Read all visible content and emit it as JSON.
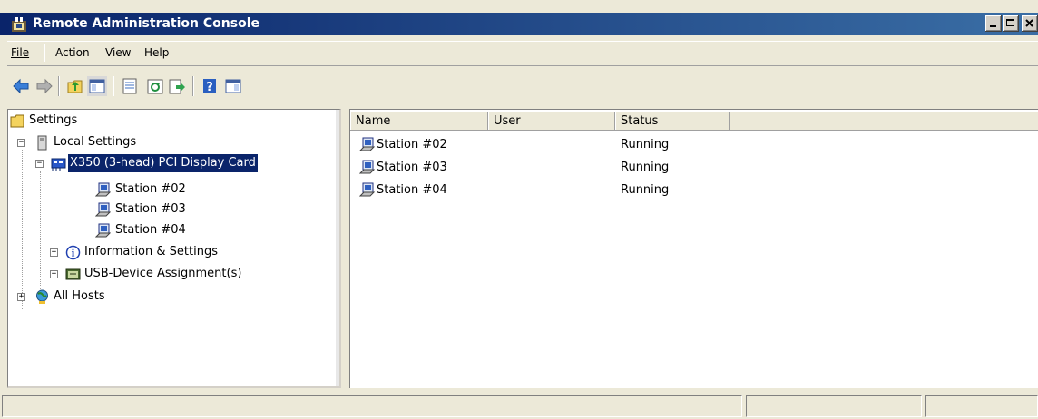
{
  "window": {
    "title": "Remote Administration Console",
    "icon": "mmc-console-icon"
  },
  "menu": {
    "items": [
      {
        "label": "File",
        "mnemonic": "F"
      },
      {
        "label": "Action",
        "mnemonic": "A"
      },
      {
        "label": "View",
        "mnemonic": "V"
      },
      {
        "label": "Help",
        "mnemonic": "H"
      }
    ]
  },
  "toolbar": {
    "buttons": [
      "back-arrow-icon",
      "forward-arrow-icon",
      "up-folder-icon",
      "show-hide-tree-icon",
      "properties-icon",
      "refresh-icon",
      "export-list-icon",
      "help-icon",
      "show-action-pane-icon"
    ]
  },
  "tree": {
    "root": "Settings",
    "local_settings": "Local Settings",
    "card": "X350 (3-head)  PCI Display Card",
    "stations": [
      "Station #02",
      "Station #03",
      "Station #04"
    ],
    "info": "Information & Settings",
    "usb": "USB-Device Assignment(s)",
    "all_hosts": "All Hosts",
    "expander_minus": "−",
    "expander_plus": "+"
  },
  "list": {
    "columns": [
      "Name",
      "User",
      "Status"
    ],
    "rows": [
      {
        "name": "Station #02",
        "user": "",
        "status": "Running"
      },
      {
        "name": "Station #03",
        "user": "",
        "status": "Running"
      },
      {
        "name": "Station #04",
        "user": "",
        "status": "Running"
      }
    ]
  },
  "colors": {
    "titlebar": "#0a246a",
    "selection": "#0a246a",
    "face": "#ece9d8"
  }
}
